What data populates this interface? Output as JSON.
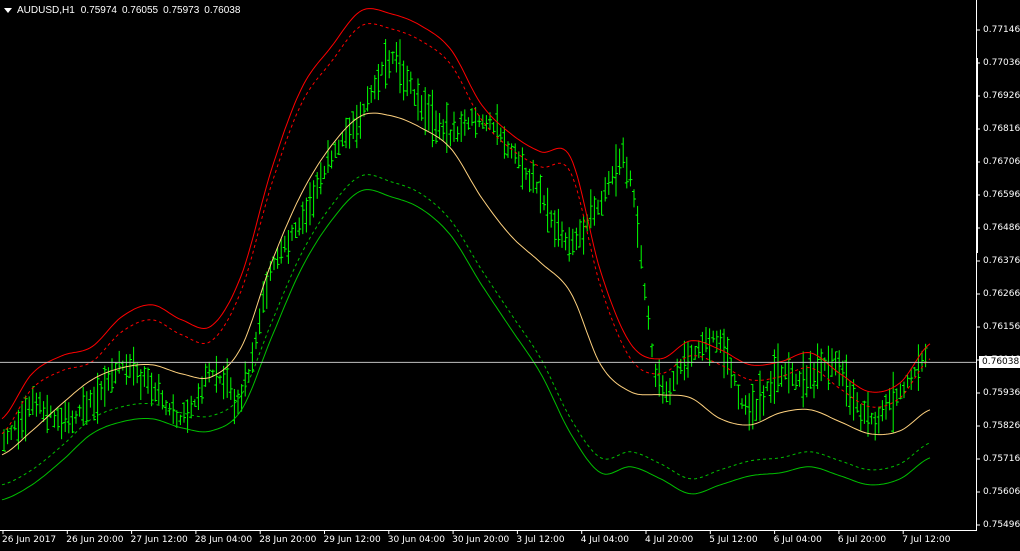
{
  "chart_info": {
    "symbol": "AUDUSD,H1",
    "open": "0.75974",
    "high": "0.76055",
    "low": "0.75973",
    "close": "0.76038"
  },
  "current_price_label": "0.76038",
  "colors": {
    "background": "#000000",
    "candles": "#00ff00",
    "bid_line": "#c0c0c0",
    "upper_band_outer": "#ff0000",
    "upper_band_inner": "#ff0000",
    "middle_line": "#ffd27f",
    "lower_band_inner": "#00c000",
    "lower_band_outer": "#00c000",
    "axis": "#ffffff"
  },
  "chart_data": {
    "type": "line",
    "price_scale": [
      "0.77146",
      "0.77036",
      "0.76926",
      "0.76816",
      "0.76706",
      "0.76596",
      "0.76486",
      "0.76376",
      "0.76266",
      "0.76156",
      "0.76046",
      "0.75936",
      "0.75826",
      "0.75716",
      "0.75606",
      "0.75496"
    ],
    "time_axis": [
      "26 Jun 2017",
      "26 Jun 20:00",
      "27 Jun 12:00",
      "28 Jun 04:00",
      "28 Jun 20:00",
      "29 Jun 12:00",
      "30 Jun 04:00",
      "30 Jun 20:00",
      "3 Jul 12:00",
      "4 Jul 04:00",
      "4 Jul 20:00",
      "5 Jul 12:00",
      "6 Jul 04:00",
      "6 Jul 20:00",
      "7 Jul 12:00"
    ],
    "ylim": [
      0.75476,
      0.77206
    ],
    "series": [
      {
        "key": "upper_outer",
        "values": [
          0.7585,
          0.76,
          0.7606,
          0.7609,
          0.7619,
          0.7623,
          0.7618,
          0.7616,
          0.7633,
          0.7668,
          0.7695,
          0.7709,
          0.7721,
          0.772,
          0.7716,
          0.7708,
          0.769,
          0.768,
          0.7674,
          0.7672,
          0.7634,
          0.761,
          0.7605,
          0.7611,
          0.7608,
          0.7603,
          0.7604,
          0.7607,
          0.76,
          0.7594,
          0.7597,
          0.761
        ]
      },
      {
        "key": "upper_inner",
        "values": [
          0.758,
          0.7595,
          0.7601,
          0.7604,
          0.7614,
          0.7618,
          0.7613,
          0.7611,
          0.7628,
          0.7663,
          0.769,
          0.7704,
          0.7716,
          0.7715,
          0.7711,
          0.7703,
          0.7685,
          0.7675,
          0.7669,
          0.7667,
          0.7629,
          0.7605,
          0.76,
          0.7606,
          0.7603,
          0.7598,
          0.7599,
          0.7602,
          0.7595,
          0.7589,
          0.7592,
          0.7605
        ]
      },
      {
        "key": "middle",
        "values": [
          0.7573,
          0.7581,
          0.759,
          0.7598,
          0.7602,
          0.7603,
          0.76,
          0.7599,
          0.7609,
          0.7637,
          0.766,
          0.7676,
          0.7686,
          0.7686,
          0.7682,
          0.7675,
          0.7659,
          0.7646,
          0.7637,
          0.7627,
          0.7603,
          0.7594,
          0.7593,
          0.7592,
          0.7585,
          0.7583,
          0.7587,
          0.7588,
          0.7584,
          0.758,
          0.7581,
          0.7588
        ]
      },
      {
        "key": "lower_inner",
        "values": [
          0.7563,
          0.7568,
          0.7576,
          0.7585,
          0.7589,
          0.759,
          0.7587,
          0.7586,
          0.7593,
          0.7617,
          0.764,
          0.7656,
          0.7666,
          0.7664,
          0.766,
          0.7651,
          0.7635,
          0.762,
          0.7605,
          0.7585,
          0.7572,
          0.7574,
          0.757,
          0.7565,
          0.7568,
          0.7571,
          0.7572,
          0.7574,
          0.7571,
          0.7568,
          0.757,
          0.7577
        ]
      },
      {
        "key": "lower_outer",
        "values": [
          0.7558,
          0.7563,
          0.7571,
          0.758,
          0.7584,
          0.7585,
          0.7582,
          0.7581,
          0.7588,
          0.7612,
          0.7635,
          0.7651,
          0.7661,
          0.7659,
          0.7655,
          0.7646,
          0.763,
          0.7615,
          0.76,
          0.758,
          0.7567,
          0.7569,
          0.7565,
          0.756,
          0.7563,
          0.7566,
          0.7567,
          0.7569,
          0.7566,
          0.7563,
          0.7565,
          0.7572
        ]
      },
      {
        "key": "close_path",
        "values": [
          0.7578,
          0.759,
          0.7584,
          0.7591,
          0.7603,
          0.7595,
          0.7585,
          0.76,
          0.7593,
          0.7635,
          0.765,
          0.7672,
          0.7685,
          0.7705,
          0.769,
          0.768,
          0.7685,
          0.7675,
          0.766,
          0.7645,
          0.7655,
          0.7668,
          0.7598,
          0.7605,
          0.7612,
          0.7588,
          0.76,
          0.7598,
          0.7603,
          0.7585,
          0.7592,
          0.7604
        ]
      }
    ]
  }
}
